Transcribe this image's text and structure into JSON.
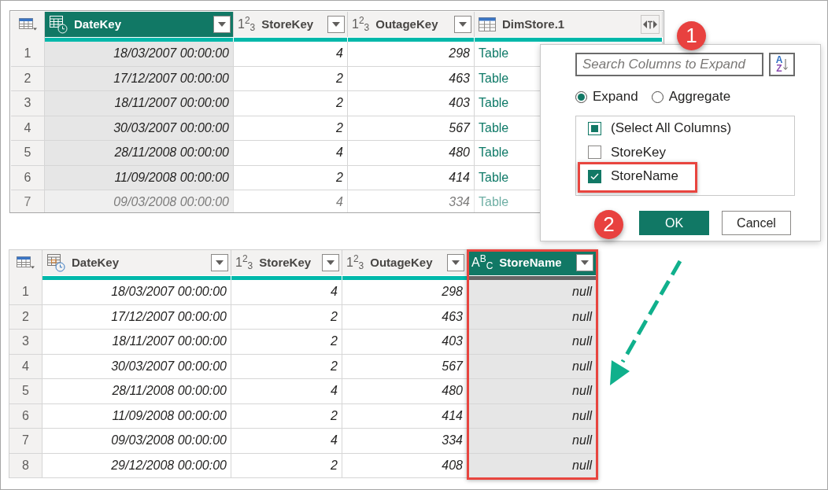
{
  "before_table": {
    "columns": [
      {
        "title": "DateKey",
        "kind": "datetime",
        "selected": true,
        "empty": false
      },
      {
        "title": "StoreKey",
        "kind": "number",
        "type_glyph": "1$^{2}$$_{3}$",
        "selected": false,
        "empty": false
      },
      {
        "title": "OutageKey",
        "kind": "number",
        "type_glyph": "1$^{2}$$_{3}$",
        "selected": false,
        "empty": false
      },
      {
        "title": "DimStore.1",
        "kind": "table",
        "selected": false,
        "empty": false
      }
    ],
    "rows": [
      {
        "number": "1",
        "cells": [
          "18/03/2007 00:00:00",
          "4",
          "298",
          "Table"
        ],
        "faded": false
      },
      {
        "number": "2",
        "cells": [
          "17/12/2007 00:00:00",
          "2",
          "463",
          "Table"
        ],
        "faded": false
      },
      {
        "number": "3",
        "cells": [
          "18/11/2007 00:00:00",
          "2",
          "403",
          "Table"
        ],
        "faded": false
      },
      {
        "number": "4",
        "cells": [
          "30/03/2007 00:00:00",
          "2",
          "567",
          "Table"
        ],
        "faded": false
      },
      {
        "number": "5",
        "cells": [
          "28/11/2008 00:00:00",
          "4",
          "480",
          "Table"
        ],
        "faded": false
      },
      {
        "number": "6",
        "cells": [
          "11/09/2008 00:00:00",
          "2",
          "414",
          "Table"
        ],
        "faded": false
      },
      {
        "number": "7",
        "cells": [
          "09/03/2008 00:00:00",
          "4",
          "334",
          "Table"
        ],
        "faded": true
      }
    ]
  },
  "expand_dialog": {
    "search": {
      "placeholder": "Search Columns to Expand"
    },
    "sort_button": {
      "letters": [
        "A",
        "Z"
      ]
    },
    "modes": [
      {
        "label": "Expand",
        "selected": true
      },
      {
        "label": "Aggregate",
        "selected": false
      }
    ],
    "columns": [
      {
        "label": "(Select All Columns)",
        "checked": false,
        "indeterminate": true,
        "highlighted": false
      },
      {
        "label": "StoreKey",
        "checked": false,
        "indeterminate": false,
        "highlighted": false
      },
      {
        "label": "StoreName",
        "checked": true,
        "indeterminate": false,
        "highlighted": true
      }
    ],
    "buttons": [
      {
        "label": "OK",
        "kind": "primary"
      },
      {
        "label": "Cancel",
        "kind": "secondary"
      }
    ]
  },
  "callouts": [
    {
      "label": "1"
    },
    {
      "label": "2"
    }
  ],
  "after_table": {
    "columns": [
      {
        "title": "DateKey",
        "kind": "datetime",
        "selected": false,
        "empty": false,
        "highlighted": false
      },
      {
        "title": "StoreKey",
        "kind": "number",
        "type_glyph": "1$^{2}$$_{3}$",
        "selected": false,
        "empty": false,
        "highlighted": false
      },
      {
        "title": "OutageKey",
        "kind": "number",
        "type_glyph": "1$^{2}$$_{3}$",
        "selected": false,
        "empty": false,
        "highlighted": false
      },
      {
        "title": "StoreName",
        "kind": "text",
        "type_glyph": "A$^{B}$$_{C}$",
        "selected": true,
        "empty": true,
        "highlighted": true
      }
    ],
    "rows": [
      {
        "number": "1",
        "cells": [
          "18/03/2007 00:00:00",
          "4",
          "298",
          "null"
        ]
      },
      {
        "number": "2",
        "cells": [
          "17/12/2007 00:00:00",
          "2",
          "463",
          "null"
        ]
      },
      {
        "number": "3",
        "cells": [
          "18/11/2007 00:00:00",
          "2",
          "403",
          "null"
        ]
      },
      {
        "number": "4",
        "cells": [
          "30/03/2007 00:00:00",
          "2",
          "567",
          "null"
        ]
      },
      {
        "number": "5",
        "cells": [
          "28/11/2008 00:00:00",
          "4",
          "480",
          "null"
        ]
      },
      {
        "number": "6",
        "cells": [
          "11/09/2008 00:00:00",
          "2",
          "414",
          "null"
        ]
      },
      {
        "number": "7",
        "cells": [
          "09/03/2008 00:00:00",
          "4",
          "334",
          "null"
        ]
      },
      {
        "number": "8",
        "cells": [
          "29/12/2008 00:00:00",
          "2",
          "408",
          "null"
        ]
      }
    ]
  }
}
